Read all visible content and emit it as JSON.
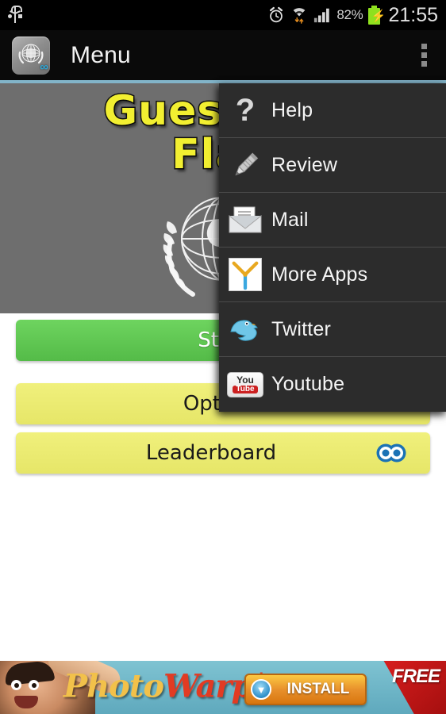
{
  "status_bar": {
    "usb_icon": "usb-icon",
    "alarm_icon": "alarm-clock-icon",
    "wifi_icon": "wifi-icon",
    "signal_icon": "signal-bars-icon",
    "battery_percent": "82%",
    "battery_icon": "battery-charging-icon",
    "clock": "21:55"
  },
  "action_bar": {
    "app_icon": "app-logo-icon",
    "app_icon_badge": "∞",
    "title": "Menu",
    "overflow_icon": "overflow-menu-icon"
  },
  "game": {
    "title_line1": "Guess the",
    "title_line2": "Flag",
    "emblem_icon": "un-emblem-icon",
    "buttons": [
      {
        "id": "start",
        "label": "Start",
        "color": "#54bb48"
      },
      {
        "id": "options",
        "label": "Options",
        "color": "#e6e668"
      },
      {
        "id": "leaderboard",
        "label": "Leaderboard",
        "color": "#e6e668",
        "icon": "scoreloop-icon"
      }
    ]
  },
  "overflow_menu": {
    "items": [
      {
        "label": "Help",
        "icon": "question-mark-icon"
      },
      {
        "label": "Review",
        "icon": "pencil-icon"
      },
      {
        "label": "Mail",
        "icon": "envelope-icon"
      },
      {
        "label": "More Apps",
        "icon": "more-apps-icon"
      },
      {
        "label": "Twitter",
        "icon": "twitter-bird-icon"
      },
      {
        "label": "Youtube",
        "icon": "youtube-icon"
      }
    ]
  },
  "ad_banner": {
    "brand_part1": "Photo",
    "brand_part2": "Warp",
    "brand_plus": "+",
    "install_label": "INSTALL",
    "free_label": "FREE",
    "download_icon": "download-arrow-icon",
    "face_icon": "ad-character-icon"
  },
  "colors": {
    "accent_line": "#82b4c9",
    "panel_gray": "#6e6e6e",
    "menu_bg": "#2c2c2c",
    "menu_divider": "#4b4b4b",
    "title_yellow": "#f2ef31",
    "button_green": "#54bb48",
    "button_yellow": "#e6e668",
    "battery_green": "#8fe11e"
  }
}
